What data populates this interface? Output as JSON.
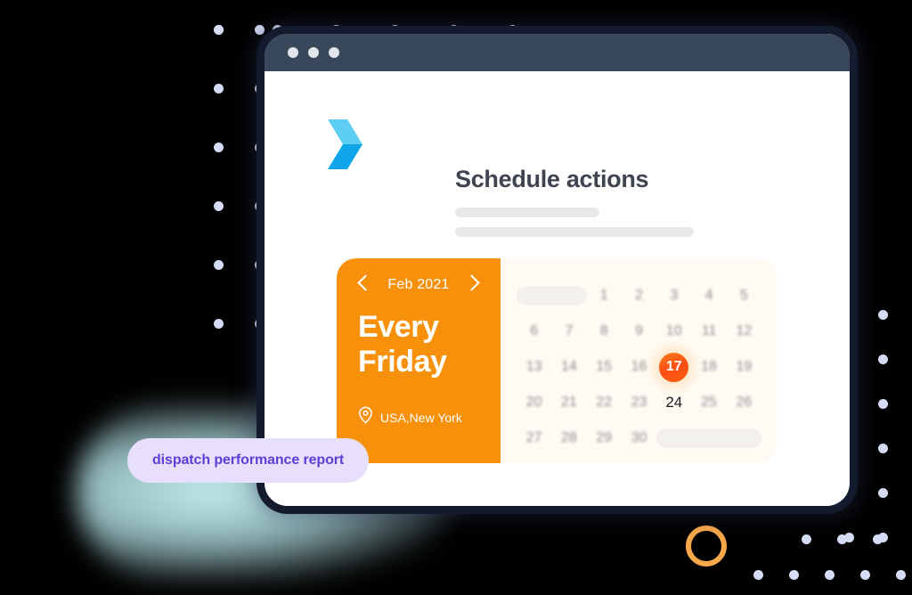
{
  "window": {
    "titlebar_dots": 3,
    "logo_icon": "chevron-logo-icon",
    "logo_color_top": "#5ecdf2",
    "logo_color_bottom": "#0ea5e9"
  },
  "header": {
    "title": "Schedule actions",
    "skeleton_lines": 2
  },
  "schedule": {
    "prev_icon": "chevron-left-icon",
    "next_icon": "chevron-right-icon",
    "month": "Feb 2021",
    "recurrence": "Every\nFriday",
    "recurrence_line_1": "Every",
    "recurrence_line_2": "Friday",
    "location_icon": "map-pin-icon",
    "location": "USA,New York",
    "panel_color": "#f7910b"
  },
  "calendar": {
    "background": "#fffbf4",
    "today": "17",
    "today_color": "#fb4d14",
    "focus_day": "24",
    "rows": [
      [
        {
          "type": "pill",
          "span": 2
        },
        {
          "type": "day",
          "label": "1"
        },
        {
          "type": "day",
          "label": "2"
        },
        {
          "type": "day",
          "label": "3"
        },
        {
          "type": "day",
          "label": "4"
        },
        {
          "type": "day",
          "label": "5"
        }
      ],
      [
        {
          "type": "day",
          "label": "6"
        },
        {
          "type": "day",
          "label": "7"
        },
        {
          "type": "day",
          "label": "8"
        },
        {
          "type": "day",
          "label": "9"
        },
        {
          "type": "day",
          "label": "10"
        },
        {
          "type": "day",
          "label": "11"
        },
        {
          "type": "day",
          "label": "12"
        }
      ],
      [
        {
          "type": "day",
          "label": "13"
        },
        {
          "type": "day",
          "label": "14"
        },
        {
          "type": "day",
          "label": "15"
        },
        {
          "type": "day",
          "label": "16"
        },
        {
          "type": "day",
          "label": "17",
          "state": "today"
        },
        {
          "type": "day",
          "label": "18"
        },
        {
          "type": "day",
          "label": "19"
        }
      ],
      [
        {
          "type": "day",
          "label": "20"
        },
        {
          "type": "day",
          "label": "21"
        },
        {
          "type": "day",
          "label": "22"
        },
        {
          "type": "day",
          "label": "23"
        },
        {
          "type": "day",
          "label": "24",
          "state": "sharp"
        },
        {
          "type": "day",
          "label": "25"
        },
        {
          "type": "day",
          "label": "26"
        }
      ],
      [
        {
          "type": "day",
          "label": "27"
        },
        {
          "type": "day",
          "label": "28"
        },
        {
          "type": "day",
          "label": "29"
        },
        {
          "type": "day",
          "label": "30"
        },
        {
          "type": "pill",
          "span": 3
        }
      ]
    ]
  },
  "badge": {
    "label": "dispatch performance report",
    "text_color": "#5b3fd6",
    "background": "#e7dffb"
  },
  "decor": {
    "dot_color": "#d6dcf5",
    "ring_color": "#f9a94a",
    "background": "#000000"
  }
}
